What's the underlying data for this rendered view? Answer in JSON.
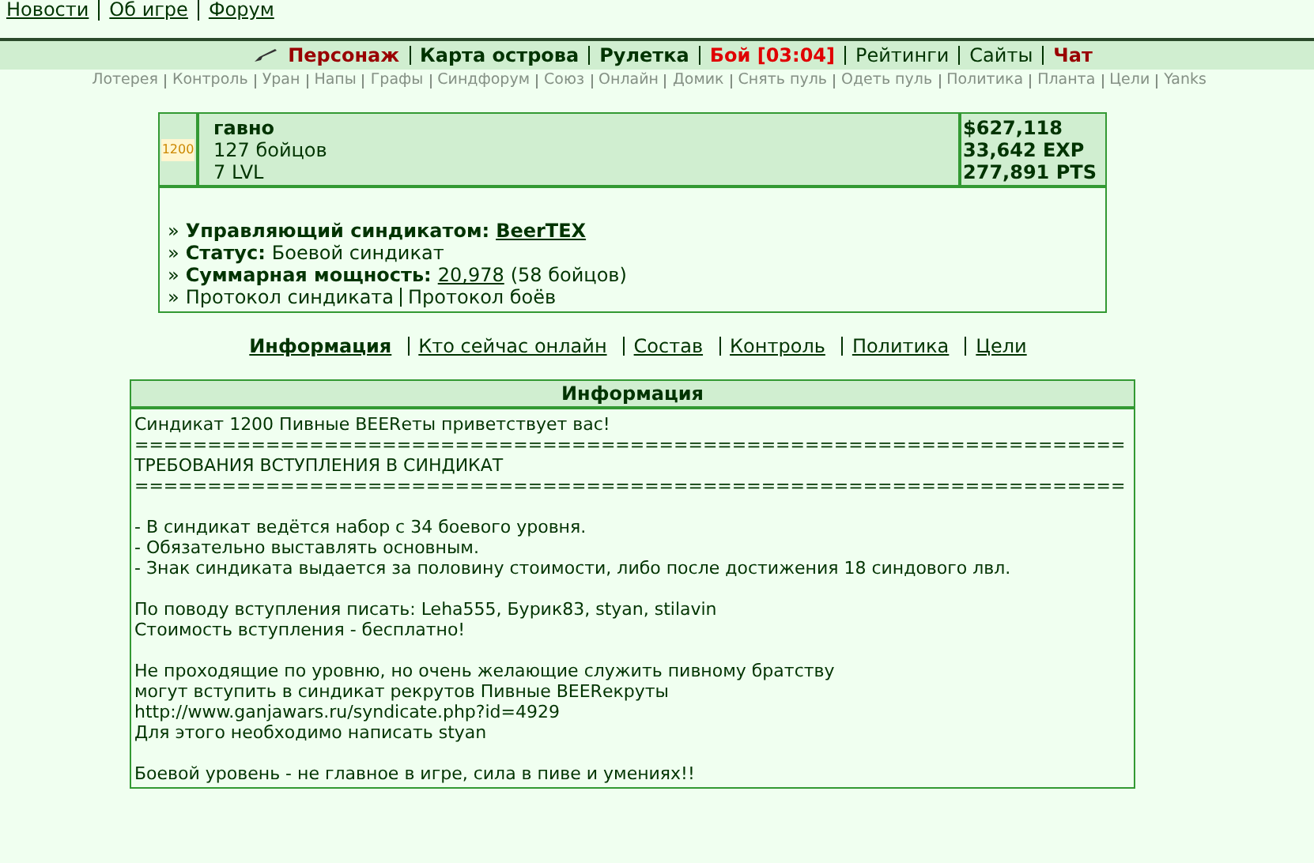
{
  "top_links": [
    "Новости",
    "Об игре",
    "Форум"
  ],
  "main_nav": [
    {
      "label": "Персонаж",
      "kind": "danger"
    },
    {
      "label": "Карта острова",
      "kind": "strong"
    },
    {
      "label": "Рулетка",
      "kind": "strong"
    },
    {
      "label": "Бой [03:04]",
      "kind": "alert"
    },
    {
      "label": "Рейтинги",
      "kind": "plain"
    },
    {
      "label": "Сайты",
      "kind": "plain"
    },
    {
      "label": "Чат",
      "kind": "danger"
    }
  ],
  "sub_nav": [
    "Лотерея",
    "Контроль",
    "Уран",
    "Напы",
    "Графы",
    "Синдфорум",
    "Союз",
    "Онлайн",
    "Домик",
    "Снять пуль",
    "Одеть пуль",
    "Политика",
    "Планта",
    "Цели",
    "Yanks"
  ],
  "syndicate": {
    "badge": "1200",
    "name": "гавно",
    "members": "127 бойцов",
    "level": "7 LVL",
    "money": "$627,118",
    "exp": "33,642 EXP",
    "pts": "277,891 PTS",
    "details": [
      {
        "kind": "link",
        "bullet": "»",
        "label": "Управляющий синдикатом:",
        "value": "BeerTEX"
      },
      {
        "kind": "text",
        "bullet": "»",
        "label": "Статус:",
        "value": "Боевой синдикат"
      },
      {
        "kind": "power",
        "bullet": "»",
        "label": "Суммарная мощность:",
        "value": "20,978",
        "extra": "(58 бойцов)"
      }
    ],
    "protocols": {
      "bullet": "»",
      "links": [
        "Протокол синдиката",
        "Протокол боёв"
      ]
    }
  },
  "tabs": [
    {
      "label": "Информация",
      "selected": true
    },
    {
      "label": "Кто сейчас онлайн",
      "selected": false
    },
    {
      "label": "Состав",
      "selected": false
    },
    {
      "label": "Контроль",
      "selected": false
    },
    {
      "label": "Политика",
      "selected": false
    },
    {
      "label": "Цели",
      "selected": false
    }
  ],
  "info": {
    "title": "Информация",
    "blocks": [
      [
        "Синдикат 1200 Пивные BEERеты приветствует вас!",
        "====================================================================",
        "ТРЕБОВАНИЯ ВСТУПЛЕНИЯ В СИНДИКАТ",
        "===================================================================="
      ],
      [
        "- В синдикат ведётся набор с 34 боевого уровня.",
        "- Обязательно выставлять основным.",
        "- Знак синдиката выдается за половину стоимости, либо после достижения 18 синдового лвл."
      ],
      [
        "По поводу вступления писать: Leha555, Бурик83, styan, stilavin",
        "Стоимость вступления - бесплатно!"
      ],
      [
        "Не проходящие по уровню, но очень желающие служить пивному братству",
        "могут вступить в синдикат рекрутов Пивные BEERекруты",
        "http://www.ganjawars.ru/syndicate.php?id=4929",
        "Для этого необходимо написать styan"
      ],
      [
        "Боевой уровень - не главное в игре, сила в пиве и умениях!!"
      ]
    ]
  }
}
